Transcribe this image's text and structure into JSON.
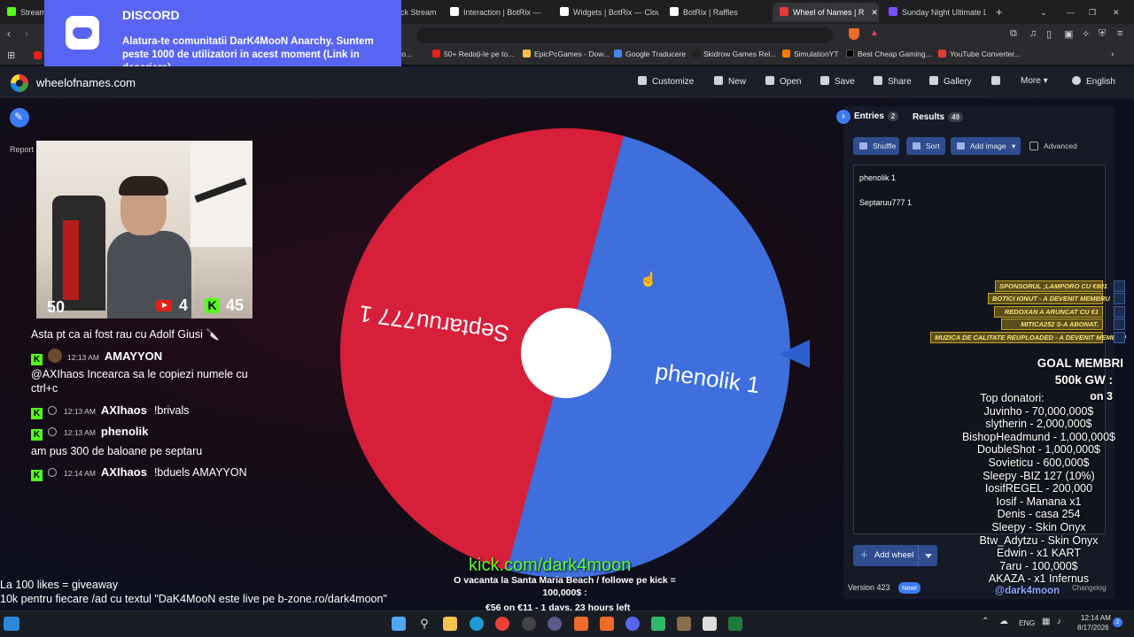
{
  "browser": {
    "tabs": [
      {
        "label": "Stream",
        "color": "#53fc18"
      },
      {
        "label": "ck Stream",
        "color": "#888888"
      },
      {
        "label": "Interaction | BotRix —",
        "color": "#ffffff"
      },
      {
        "label": "Widgets | BotRix — Cloud",
        "color": "#ffffff"
      },
      {
        "label": "BotRix | Raffles",
        "color": "#ffffff"
      },
      {
        "label": "Wheel of Names | R",
        "color": "#e53935",
        "active": true
      },
      {
        "label": "Sunday Night Ultimate La",
        "color": "#7c4dff"
      }
    ],
    "bookmarks": [
      {
        "label": "3 Co...",
        "color": "#888888"
      },
      {
        "label": "50+ Redați-le pe to...",
        "color": "#e62117"
      },
      {
        "label": "EpicPcGames - Dow...",
        "color": "#f6c244"
      },
      {
        "label": "Google Traducere",
        "color": "#4285f4"
      },
      {
        "label": "Skidrow Games Rel...",
        "color": "#222222"
      },
      {
        "label": "SimulationYT",
        "color": "#f57c00"
      },
      {
        "label": "Best Cheap Gaming...",
        "color": "#000000"
      },
      {
        "label": "YouTube Converter...",
        "color": "#e53935"
      }
    ]
  },
  "discord_notification": {
    "title": "DISCORD",
    "text": "Alatura-te comunitatii DarK4MooN Anarchy. Suntem peste 1000 de utilizatori in acest moment (Link in descriere)."
  },
  "header": {
    "site_name": "wheelofnames.com",
    "nav": [
      {
        "label": "Customize",
        "x": 0
      },
      {
        "label": "New"
      },
      {
        "label": "Open"
      },
      {
        "label": "Save"
      },
      {
        "label": "Share"
      },
      {
        "label": "Gallery"
      },
      {
        "label": "Fullscreen-icon"
      },
      {
        "label": "More"
      },
      {
        "label": "English"
      }
    ]
  },
  "page": {
    "report_label": "Report"
  },
  "webcam": {
    "count_left": "50",
    "youtube_count": "4",
    "kick_count": "45"
  },
  "chat": {
    "messages": [
      {
        "text": "Asta pt ca ai fost rau cu Adolf Giusi 🔪"
      },
      {
        "time": "12:13 AM",
        "user": "AMAYYON",
        "text": ""
      },
      {
        "text": "@AXIhaos Incearca sa le copiezi numele cu"
      },
      {
        "text": "ctrl+c"
      },
      {
        "time": "12:13 AM",
        "user": "AXIhaos",
        "text": "!brivals"
      },
      {
        "time": "12:13 AM",
        "user": "phenolik",
        "text": ""
      },
      {
        "text": "am pus 300 de baloane pe septaru"
      },
      {
        "time": "12:14 AM",
        "user": "AXIhaos",
        "text": "!bduels AMAYYON"
      }
    ]
  },
  "wheel": {
    "segments": [
      {
        "label": "phenolik 1",
        "color": "#3e6fdc"
      },
      {
        "label": "Septaruu777 1",
        "color": "#d71f3a"
      }
    ]
  },
  "panel": {
    "entries_tab": "Entries",
    "entries_count": "2",
    "results_tab": "Results",
    "results_count": "49",
    "shuffle": "Shuffle",
    "sort": "Sort",
    "add_image": "Add image",
    "advanced": "Advanced",
    "entries": [
      "phenolik 1",
      "Septaruu777 1"
    ],
    "add_wheel": "Add wheel",
    "version": "Version 423",
    "new_badge": "New!",
    "changelog": "Changelog"
  },
  "alerts": [
    "SPONSORUL ;LAMPORO CU €801",
    "BOTICI IONUT - A DEVENIT MEMBRU",
    "REDOXAN A ARUNCAT CU €1",
    "MITICA252 S-A ABONAT.",
    "MUZICA DE CALITATE REUPLOADED - A DEVENIT MEMBRU"
  ],
  "goals": {
    "line1": "GOAL MEMBRI",
    "line2": "500k GW :",
    "line3": "on 3",
    "donors_title": "Top donatori:",
    "donors": [
      "Juvinho - 70,000,000$",
      "slytherin - 2,000,000$",
      "BishopHeadmund - 1,000,000$",
      "DoubleShot - 1,000,000$",
      "Sovieticu - 600,000$",
      "Sleepy -BIZ 127 (10%)",
      "IosifREGEL - 200,000",
      "Iosif - Manana x1",
      "Denis - casa 254",
      "Sleepy - Skin Onyx",
      "Btw_Adytzu - Skin Onyx",
      "Edwin - x1 KART",
      "7aru - 100,000$",
      "AKAZA - x1 Infernus"
    ],
    "discord_handle": "@dark4moon"
  },
  "bottom": {
    "likes_line1": "La 100 likes = giveaway",
    "likes_line2": "10k pentru fiecare /ad cu textul \"DaK4MooN este live pe b-zone.ro/dark4moon\"",
    "kick_url": "kick.com/dark4moon",
    "promo1": "O vacanta la Santa Maria Beach / followe pe kick = 100,000$ :",
    "promo2": "€56 on €11 - 1 days, 23 hours left"
  },
  "taskbar": {
    "lang": "ENG",
    "time": "12:14 AM",
    "date": "8/17/2026"
  }
}
